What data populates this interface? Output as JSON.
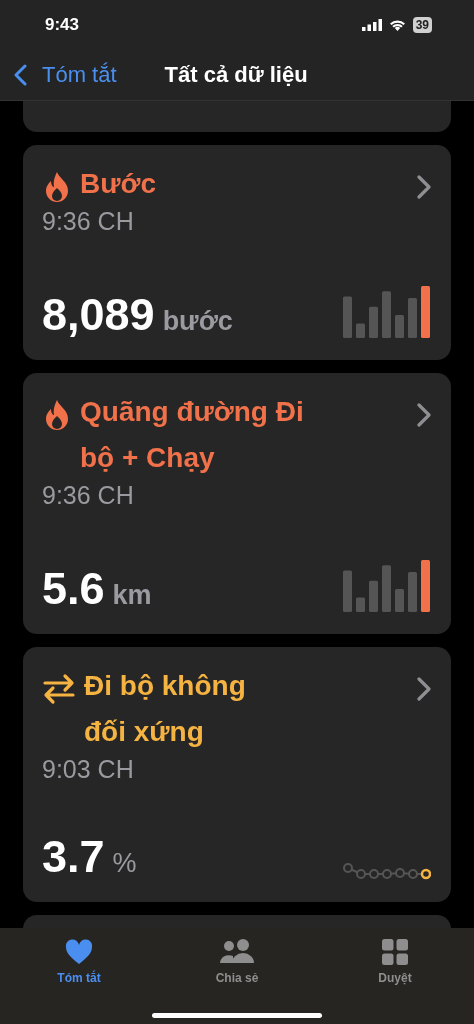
{
  "status_bar": {
    "time": "9:43",
    "battery": "39"
  },
  "nav": {
    "back": "Tóm tắt",
    "title": "Tất cả dữ liệu"
  },
  "cards": [
    {
      "kind": "steps",
      "color": "#f0714a",
      "title": "Bước",
      "time": "9:36 CH",
      "value": "8,089",
      "unit": "bước"
    },
    {
      "kind": "distance",
      "color": "#f0714a",
      "title": "Quãng đường Đi bộ + Chạy",
      "time": "9:36 CH",
      "value": "5.6",
      "unit": "km"
    },
    {
      "kind": "asymmetry",
      "color": "#f5b342",
      "title": "Đi bộ không đối xứng",
      "time": "9:03 CH",
      "value": "3.7",
      "unit": "%"
    }
  ],
  "tabs": [
    {
      "label": "Tóm tắt",
      "selected": true
    },
    {
      "label": "Chia sẻ",
      "selected": false
    },
    {
      "label": "Duyệt",
      "selected": false
    }
  ]
}
